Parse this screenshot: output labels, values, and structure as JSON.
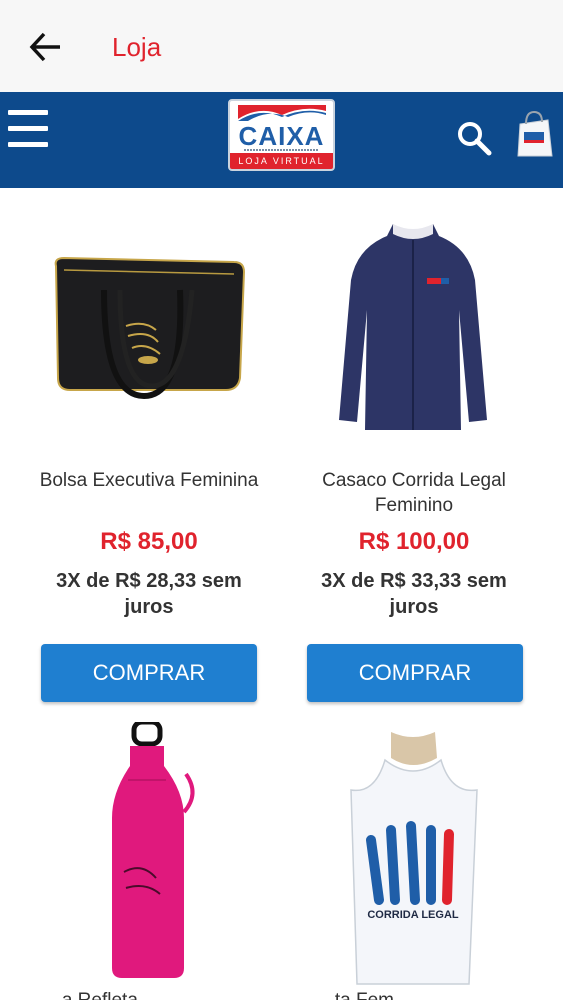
{
  "app_bar": {
    "title": "Loja"
  },
  "store_bar": {
    "logo_text": "CAIXA",
    "logo_band": "LOJA VIRTUAL"
  },
  "products": [
    {
      "name": "Bolsa Executiva Feminina",
      "price": "R$ 85,00",
      "installment": "3X de R$ 28,33 sem juros",
      "button": "COMPRAR",
      "icon": "handbag-image"
    },
    {
      "name": "Casaco Corrida Legal Feminino",
      "price": "R$ 100,00",
      "installment": "3X de R$ 33,33 sem juros",
      "button": "COMPRAR",
      "icon": "jacket-image"
    },
    {
      "name": "...a Refleta...",
      "icon": "water-bottle-image"
    },
    {
      "name": "...ta Fem...",
      "icon": "tank-top-image",
      "print_text": "CORRIDA LEGAL"
    }
  ],
  "colors": {
    "accent_red": "#e0232d",
    "header_blue": "#0d4a8c",
    "button_blue": "#1f7fd0"
  }
}
